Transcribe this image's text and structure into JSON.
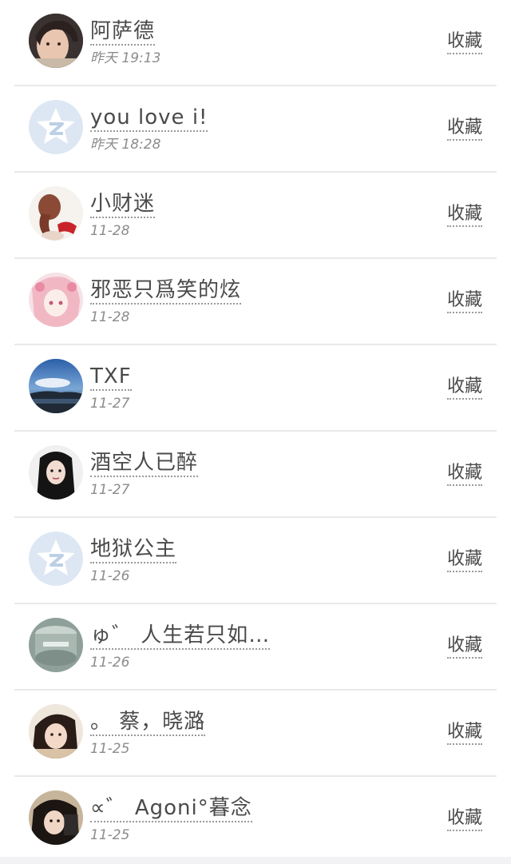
{
  "colors": {
    "text": "#4a4a4a",
    "subtext": "#8c8c8c",
    "divider": "#e9e9e9",
    "default_avatar": "#dde7f3"
  },
  "items": [
    {
      "name": "阿萨德",
      "time": "昨天 19:13",
      "action": "收藏",
      "avatar": "child-photo"
    },
    {
      "name": "you love i!",
      "time": "昨天 18:28",
      "action": "收藏",
      "avatar": "default-qq-avatar"
    },
    {
      "name": "小财迷",
      "time": "11-28",
      "action": "收藏",
      "avatar": "woman-braid-photo"
    },
    {
      "name": "邪恶只爲笑的炫",
      "time": "11-28",
      "action": "收藏",
      "avatar": "anime-girl-pink"
    },
    {
      "name": "TXF",
      "time": "11-27",
      "action": "收藏",
      "avatar": "sky-landscape"
    },
    {
      "name": "酒空人已醉",
      "time": "11-27",
      "action": "收藏",
      "avatar": "woman-dark-hair"
    },
    {
      "name": "地狱公主",
      "time": "11-26",
      "action": "收藏",
      "avatar": "default-qq-avatar"
    },
    {
      "name": "ゅ゛ 人生若只如…",
      "time": "11-26",
      "action": "收藏",
      "avatar": "glass-object"
    },
    {
      "name": "。 蔡，晓潞",
      "time": "11-25",
      "action": "收藏",
      "avatar": "girl-selfie"
    },
    {
      "name": "∝゛ Agoni°暮念",
      "time": "11-25",
      "action": "收藏",
      "avatar": "girl-dark-photo"
    }
  ]
}
